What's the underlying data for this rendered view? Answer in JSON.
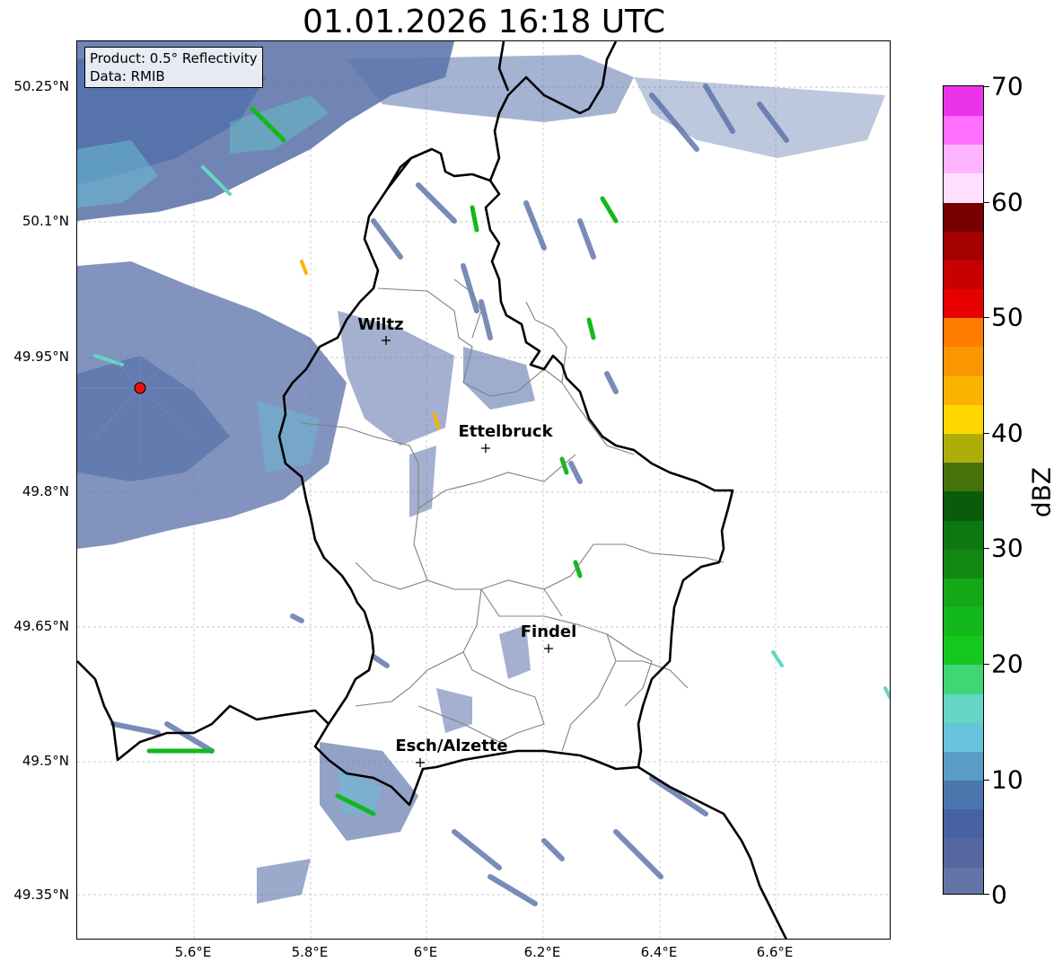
{
  "title": "01.01.2026 16:18 UTC",
  "info_box": {
    "product": "Product: 0.5° Reflectivity",
    "data_source": "Data: RMIB"
  },
  "lat_ticks": [
    "50.25°N",
    "50.1°N",
    "49.95°N",
    "49.8°N",
    "49.65°N",
    "49.5°N",
    "49.35°N"
  ],
  "lon_ticks": [
    "5.6°E",
    "5.8°E",
    "6°E",
    "6.2°E",
    "6.4°E",
    "6.6°E"
  ],
  "cities": [
    {
      "name": "Wiltz"
    },
    {
      "name": "Ettelbruck"
    },
    {
      "name": "Findel"
    },
    {
      "name": "Esch/Alzette"
    }
  ],
  "colorbar": {
    "label": "dBZ",
    "ticks": [
      "0",
      "10",
      "20",
      "30",
      "40",
      "50",
      "60",
      "70"
    ],
    "colors": [
      "#6574a6",
      "#5566a0",
      "#4761a2",
      "#4a76ad",
      "#5a9ec7",
      "#68c3dd",
      "#63d6c5",
      "#41d675",
      "#14c81e",
      "#12b81c",
      "#14a816",
      "#128a12",
      "#0d7812",
      "#0a5c0a",
      "#45730a",
      "#afae08",
      "#ffd700",
      "#fab400",
      "#fa9600",
      "#ff7d00",
      "#e60000",
      "#c80000",
      "#a50000",
      "#780000",
      "#ffe1ff",
      "#ffb4ff",
      "#ff6eff",
      "#eb32eb"
    ]
  },
  "radar_site_color": "#e81010"
}
